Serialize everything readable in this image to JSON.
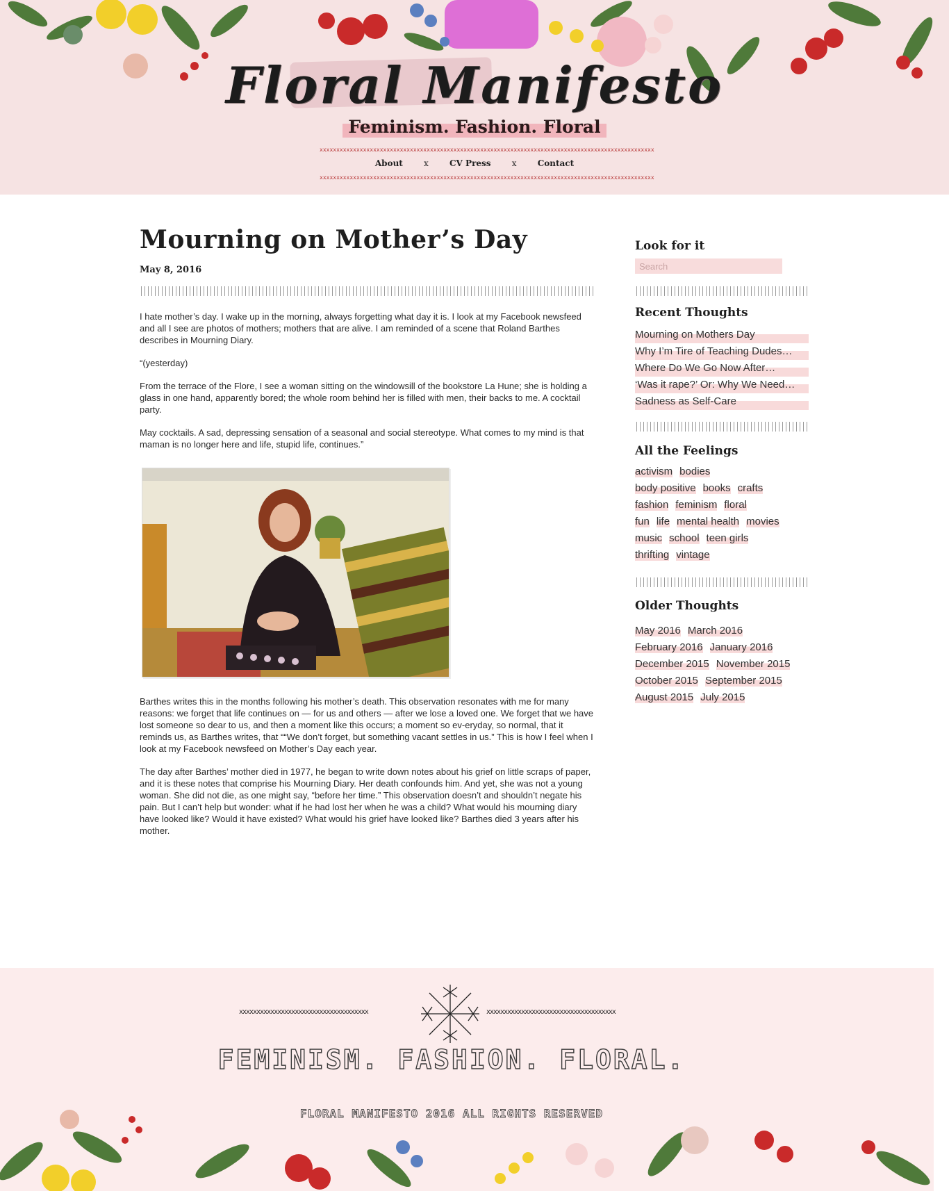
{
  "site": {
    "title": "Floral Manifesto",
    "tagline": "Feminism. Fashion. Floral"
  },
  "nav": {
    "items": [
      "About",
      "CV Press",
      "Contact"
    ],
    "separator": "x"
  },
  "post": {
    "title": "Mourning on Mother’s Day",
    "date": "May 8, 2016",
    "paragraphs_before": [
      "I hate mother’s day. I wake up in the morning, always forgetting what day it is. I look at my Facebook newsfeed and all I see are photos of mothers; mothers that are alive. I am reminded of a scene that Roland Barthes describes in Mourning Diary.",
      "“(yesterday)",
      "From the terrace of the Flore, I see a woman sitting on the windowsill of the bookstore La Hune; she is holding a glass in one hand, apparently bored; the whole room behind her is filled with men, their backs to me. A cocktail party.",
      "May cocktails. A sad, depressing sensation of a seasonal and social stereotype. What comes to my mind is that maman is no longer here and life, stupid life, continues.”"
    ],
    "paragraphs_after": [
      "Barthes writes this in the months following his mother’s death. This observation resonates with me for many reasons: we forget that life continues on — for us and others — after we lose a loved one. We forget that we have lost someone so dear to us, and then a moment like this occurs; a moment so ev-eryday, so normal, that it reminds us, as Barthes writes, that ““We don’t forget, but something vacant settles in us.” This is how I feel when I look at my Facebook newsfeed on Mother’s Day each year.",
      "The day after Barthes’ mother died in 1977, he began to write down notes about his grief on little scraps of paper, and it is these notes that comprise his Mourning Diary. Her death confounds him. And yet, she was not a young woman. She did not die, as one might say, “before her time.” This observation doesn’t and shouldn’t negate his pain. But I can’t help but wonder: what if he had lost her when he was a child? What would his mourning diary have looked like? Would it have existed? What would his grief have looked like? Barthes died 3 years after his mother."
    ]
  },
  "sidebar": {
    "search": {
      "heading": "Look for it",
      "placeholder": "Search"
    },
    "recent": {
      "heading": "Recent Thoughts",
      "items": [
        "Mourning on Mothers Day",
        "Why I’m Tire of Teaching Dudes…",
        "Where Do We Go Now After…",
        "‘Was it rape?’ Or: Why We Need…",
        "Sadness as Self-Care"
      ]
    },
    "tags": {
      "heading": "All the Feelings",
      "rows": [
        [
          "activism",
          "bodies"
        ],
        [
          "body positive",
          "books",
          "crafts"
        ],
        [
          "fashion",
          "feminism",
          "floral"
        ],
        [
          "fun",
          "life",
          "mental health",
          "movies"
        ],
        [
          "music",
          "school",
          "teen girls"
        ],
        [
          "thrifting",
          "vintage"
        ]
      ]
    },
    "archive": {
      "heading": "Older Thoughts",
      "rows": [
        [
          "May 2016",
          "March 2016"
        ],
        [
          "February 2016",
          "January 2016"
        ],
        [
          "December 2015",
          "November 2015"
        ],
        [
          "October 2015",
          "September 2015"
        ],
        [
          "August 2015",
          "July 2015"
        ]
      ]
    }
  },
  "footer": {
    "xrow": "xxxxxxxxxxxxxxxxxxxxxxxxxxxxxxxxxxxxx",
    "tagline": "FEMINISM. FASHION. FLORAL.",
    "copyright": "FLORAL MANIFESTO 2016 ALL RIGHTS RESERVED"
  },
  "colors": {
    "header_bg": "#f6e3e3",
    "footer_bg": "#fcecec",
    "highlight": "#f8dada",
    "tagline_highlight": "#f1b5bc",
    "stitch_red": "#b83838"
  }
}
